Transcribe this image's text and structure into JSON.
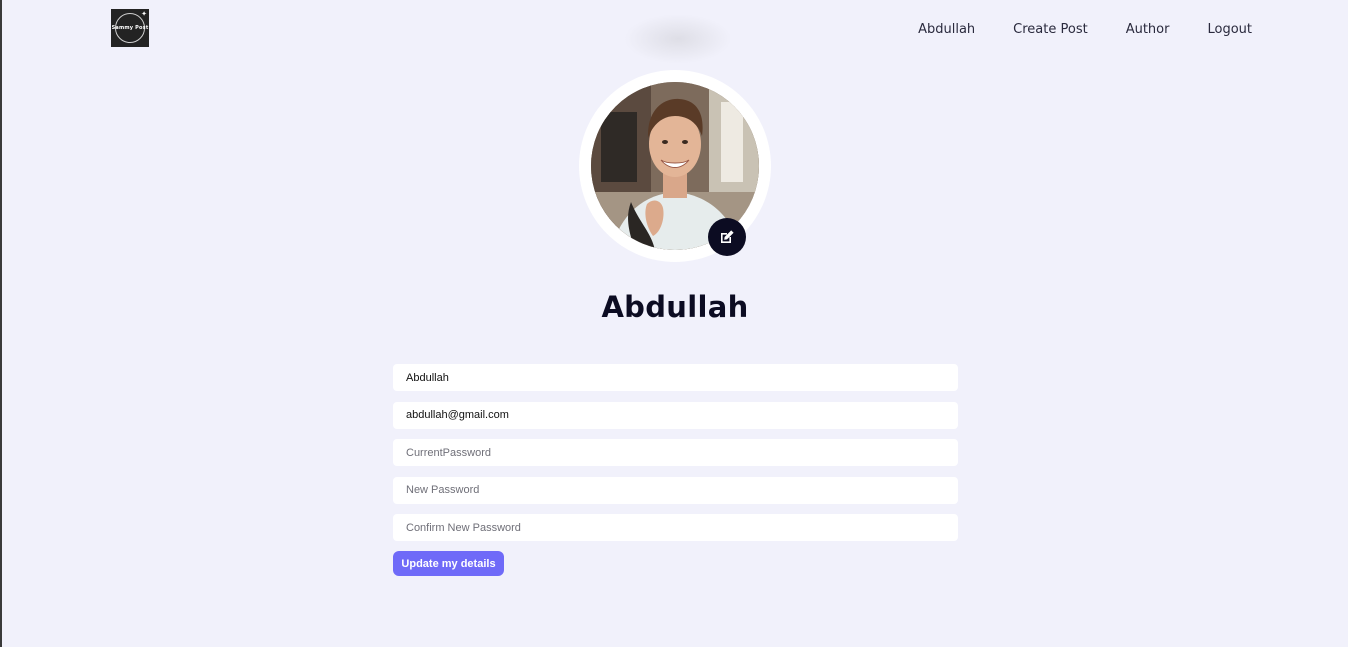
{
  "header": {
    "logo_text": "Sammy Post",
    "nav": [
      {
        "label": "Abdullah"
      },
      {
        "label": "Create Post"
      },
      {
        "label": "Author"
      },
      {
        "label": "Logout"
      }
    ]
  },
  "profile": {
    "name": "Abdullah",
    "edit_icon": "edit-icon"
  },
  "form": {
    "name_value": "Abdullah",
    "email_value": "abdullah@gmail.com",
    "current_password_placeholder": "CurrentPassword",
    "new_password_placeholder": "New Password",
    "confirm_password_placeholder": "Confirm New Password",
    "submit_label": "Update my details"
  },
  "colors": {
    "background": "#f1f1fb",
    "primary": "#6f6af8",
    "dark": "#0c0c22"
  }
}
